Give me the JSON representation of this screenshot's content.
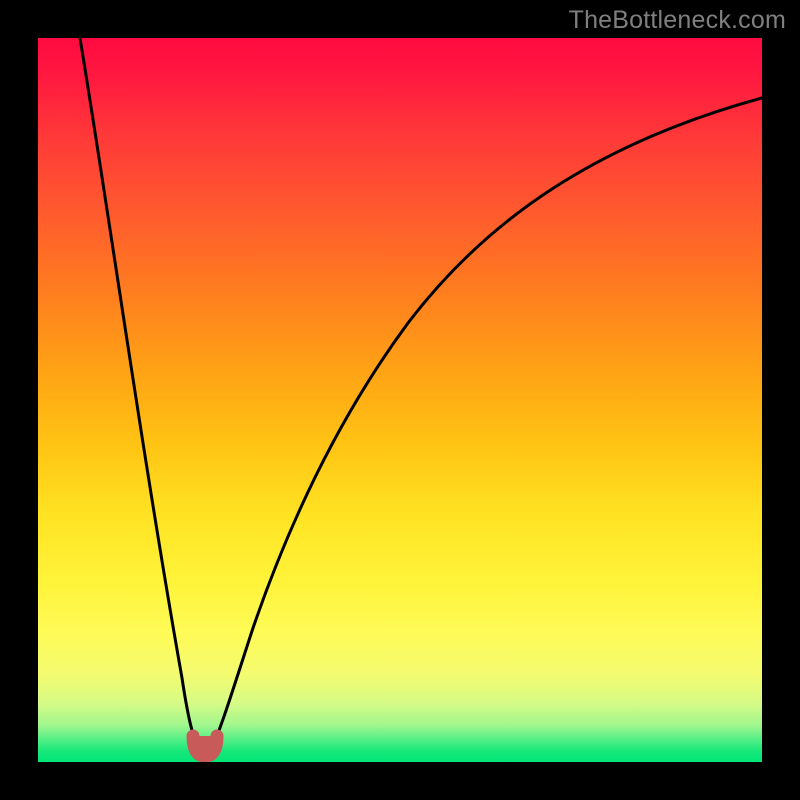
{
  "watermark": "TheBottleneck.com",
  "colors": {
    "page_bg": "#000000",
    "watermark": "#7f7f7f",
    "curve": "#000000",
    "marker": "#c85a5a",
    "gradient_top": "#ff0a41",
    "gradient_mid": "#ffe323",
    "gradient_bottom": "#00e676"
  },
  "chart_data": {
    "type": "line",
    "title": "",
    "xlabel": "",
    "ylabel": "",
    "xlim": [
      0,
      100
    ],
    "ylim": [
      0,
      100
    ],
    "grid": false,
    "legend": false,
    "annotations": [
      {
        "text": "TheBottleneck.com",
        "position": "top-right"
      }
    ],
    "series": [
      {
        "name": "bottleneck-curve",
        "x": [
          1,
          3,
          5,
          7,
          9,
          11,
          13,
          15,
          17,
          19,
          20,
          21,
          22,
          23,
          24,
          25,
          26,
          28,
          30,
          33,
          36,
          40,
          45,
          50,
          55,
          60,
          65,
          70,
          75,
          80,
          85,
          90,
          95,
          100
        ],
        "y": [
          100,
          92,
          83,
          74,
          65,
          56,
          47,
          38,
          28,
          15,
          8,
          3,
          2,
          2,
          3,
          6,
          9,
          15,
          22,
          31,
          39,
          48,
          56,
          63,
          68,
          73,
          77,
          80,
          83,
          85,
          87,
          89,
          90,
          91
        ]
      }
    ],
    "minimum": {
      "x": 22.5,
      "y": 2
    }
  }
}
